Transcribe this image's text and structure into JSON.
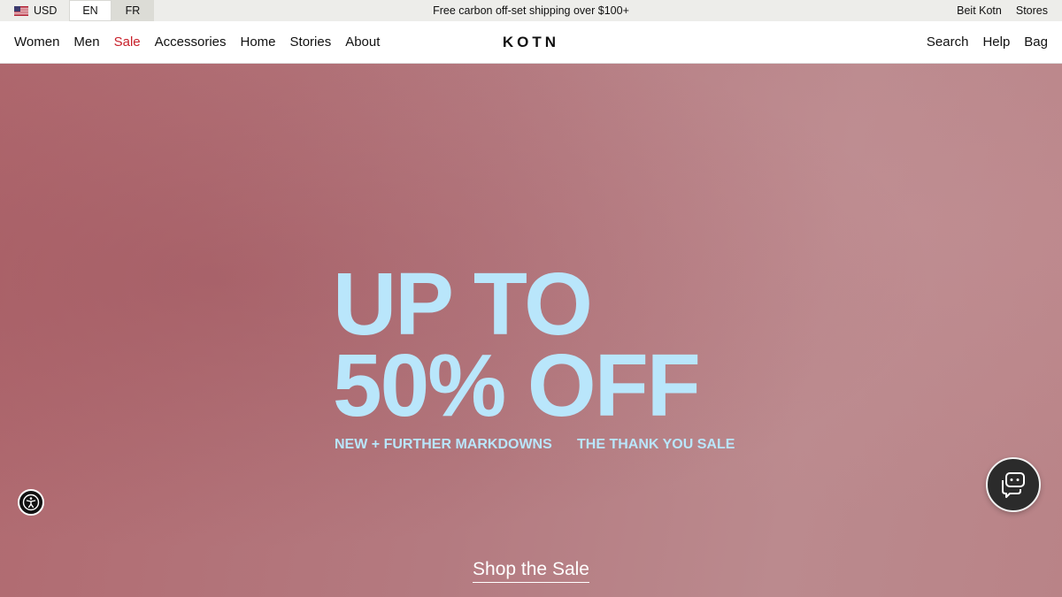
{
  "topbar": {
    "currency": "USD",
    "languages": [
      {
        "label": "EN",
        "active": true
      },
      {
        "label": "FR",
        "active": false
      }
    ],
    "promo": "Free carbon off-set shipping over $100+",
    "links": [
      "Beit Kotn",
      "Stores"
    ]
  },
  "nav": {
    "left": [
      "Women",
      "Men",
      "Sale",
      "Accessories",
      "Home",
      "Stories",
      "About"
    ],
    "logo": "KOTN",
    "right": [
      "Search",
      "Help",
      "Bag"
    ]
  },
  "hero": {
    "line1": "UP TO",
    "line2": "50% OFF",
    "sub1": "NEW + FURTHER MARKDOWNS",
    "sub2": "THE THANK YOU SALE",
    "cta": "Shop the Sale",
    "headline_color": "#b9e6fb",
    "background_color": "#b47a80"
  },
  "widgets": {
    "accessibility_icon": "accessibility-icon",
    "chat_icon": "chat-icon"
  },
  "colors": {
    "sale_red": "#c8202a",
    "topbar_bg": "#ededea"
  }
}
